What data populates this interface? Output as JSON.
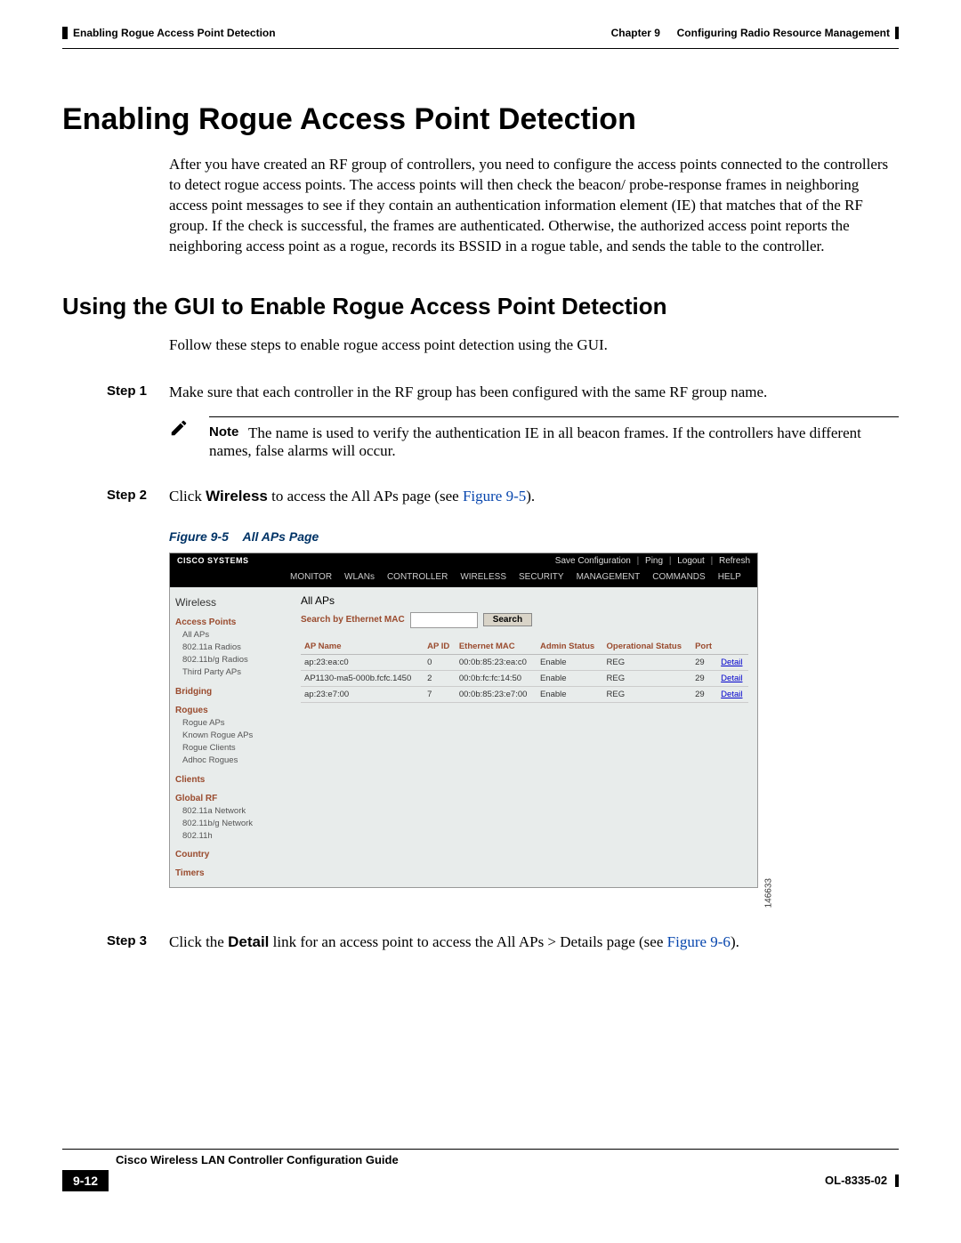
{
  "header": {
    "left": "Enabling Rogue Access Point Detection",
    "right_prefix": "Chapter 9",
    "right_title": "Configuring Radio Resource Management"
  },
  "title": "Enabling Rogue Access Point Detection",
  "intro": "After you have created an RF group of controllers, you need to configure the access points connected to the controllers to detect rogue access points. The access points will then check the beacon/ probe-response frames in neighboring access point messages to see if they contain an authentication information element (IE) that matches that of the RF group. If the check is successful, the frames are authenticated. Otherwise, the authorized access point reports the neighboring access point as a rogue, records its BSSID in a rogue table, and sends the table to the controller.",
  "section2": "Using the GUI to Enable Rogue Access Point Detection",
  "section2_intro": "Follow these steps to enable rogue access point detection using the GUI.",
  "steps": {
    "s1_label": "Step 1",
    "s1_text": "Make sure that each controller in the RF group has been configured with the same RF group name.",
    "note_label": "Note",
    "note_text": "The name is used to verify the authentication IE in all beacon frames. If the controllers have different names, false alarms will occur.",
    "s2_label": "Step 2",
    "s2_pre": "Click ",
    "s2_bold": "Wireless",
    "s2_post": " to access the All APs page (see ",
    "s2_ref": "Figure 9-5",
    "s2_end": ").",
    "s3_label": "Step 3",
    "s3_pre": "Click the ",
    "s3_bold": "Detail",
    "s3_post": " link for an access point to access the All APs > Details page (see ",
    "s3_ref": "Figure 9-6",
    "s3_end": ")."
  },
  "figcap_num": "Figure 9-5",
  "figcap_title": "All APs Page",
  "screenshot": {
    "logo": "CISCO SYSTEMS",
    "toplinks": [
      "Save Configuration",
      "Ping",
      "Logout",
      "Refresh"
    ],
    "menu": [
      "MONITOR",
      "WLANs",
      "CONTROLLER",
      "WIRELESS",
      "SECURITY",
      "MANAGEMENT",
      "COMMANDS",
      "HELP"
    ],
    "side": {
      "h0": "Wireless",
      "g1": "Access Points",
      "g1i": [
        "All APs",
        "802.11a Radios",
        "802.11b/g Radios",
        "Third Party APs"
      ],
      "g2": "Bridging",
      "g3": "Rogues",
      "g3i": [
        "Rogue APs",
        "Known Rogue APs",
        "Rogue Clients",
        "Adhoc Rogues"
      ],
      "g4": "Clients",
      "g5": "Global RF",
      "g5i": [
        "802.11a Network",
        "802.11b/g Network",
        "802.11h"
      ],
      "g6": "Country",
      "g7": "Timers"
    },
    "main_title": "All APs",
    "search_label": "Search by Ethernet MAC",
    "search_button": "Search",
    "columns": [
      "AP Name",
      "AP ID",
      "Ethernet MAC",
      "Admin Status",
      "Operational Status",
      "Port"
    ],
    "rows": [
      {
        "name": "ap:23:ea:c0",
        "id": "0",
        "mac": "00:0b:85:23:ea:c0",
        "admin": "Enable",
        "op": "REG",
        "port": "29",
        "detail": "Detail"
      },
      {
        "name": "AP1130-ma5-000b.fcfc.1450",
        "id": "2",
        "mac": "00:0b:fc:fc:14:50",
        "admin": "Enable",
        "op": "REG",
        "port": "29",
        "detail": "Detail"
      },
      {
        "name": "ap:23:e7:00",
        "id": "7",
        "mac": "00:0b:85:23:e7:00",
        "admin": "Enable",
        "op": "REG",
        "port": "29",
        "detail": "Detail"
      }
    ],
    "annot": "146633"
  },
  "footer": {
    "guide": "Cisco Wireless LAN Controller Configuration Guide",
    "page": "9-12",
    "docnum": "OL-8335-02"
  }
}
